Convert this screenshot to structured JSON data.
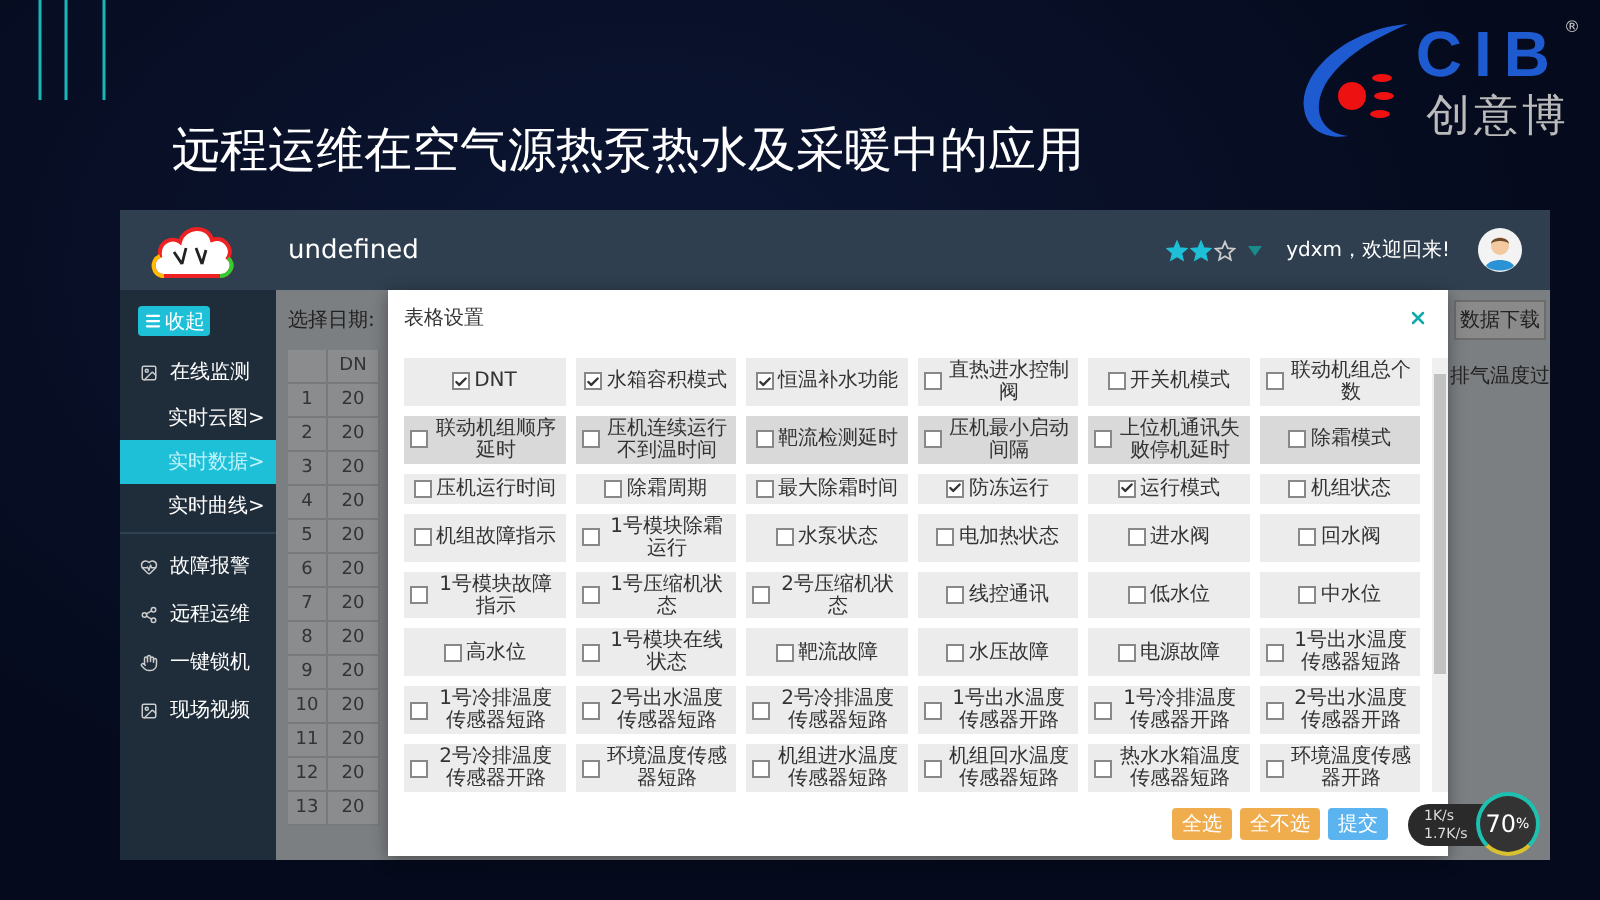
{
  "slide": {
    "title": "远程运维在空气源热泵热水及采暖中的应用"
  },
  "logo": {
    "letters": "CIB",
    "mark": "®",
    "name": "创意博"
  },
  "app": {
    "title": "undefined",
    "rating": {
      "stars": 2
    },
    "greeting": "ydxm，欢迎回来!"
  },
  "sidebar": {
    "toggle": "收起",
    "items": [
      {
        "label": "在线监测",
        "selected": false,
        "children": [
          {
            "label": "实时云图>",
            "selected": false
          },
          {
            "label": "实时数据>",
            "selected": true
          },
          {
            "label": "实时曲线>",
            "selected": false
          }
        ]
      },
      {
        "label": "故障报警",
        "selected": false
      },
      {
        "label": "远程运维",
        "selected": false
      },
      {
        "label": "一键锁机",
        "selected": false
      },
      {
        "label": "现场视频",
        "selected": false
      }
    ]
  },
  "page": {
    "date_label": "选择日期:",
    "download_button": "数据下载",
    "table": {
      "columns": [
        "DN"
      ],
      "rows": [
        {
          "index": "1",
          "cell": "20"
        },
        {
          "index": "2",
          "cell": "20"
        },
        {
          "index": "3",
          "cell": "20"
        },
        {
          "index": "4",
          "cell": "20"
        },
        {
          "index": "5",
          "cell": "20"
        },
        {
          "index": "6",
          "cell": "20"
        },
        {
          "index": "7",
          "cell": "20"
        },
        {
          "index": "8",
          "cell": "20"
        },
        {
          "index": "9",
          "cell": "20"
        },
        {
          "index": "10",
          "cell": "20"
        },
        {
          "index": "11",
          "cell": "20"
        },
        {
          "index": "12",
          "cell": "20"
        },
        {
          "index": "13",
          "cell": "20"
        }
      ],
      "right_column": "排气温度过"
    }
  },
  "dialog": {
    "title": "表格设置",
    "options": [
      {
        "label": "DNT",
        "checked": true,
        "shaded": false
      },
      {
        "label": "水箱容积模式",
        "checked": true,
        "shaded": false
      },
      {
        "label": "恒温补水功能",
        "checked": true,
        "shaded": false
      },
      {
        "label": "直热进水控制阀",
        "checked": false,
        "shaded": false
      },
      {
        "label": "开关机模式",
        "checked": false,
        "shaded": false
      },
      {
        "label": "联动机组总个数",
        "checked": false,
        "shaded": false
      },
      {
        "label": "联动机组顺序延时",
        "checked": false,
        "shaded": true
      },
      {
        "label": "压机连续运行不到温时间",
        "checked": false,
        "shaded": true
      },
      {
        "label": "靶流检测延时",
        "checked": false,
        "shaded": true
      },
      {
        "label": "压机最小启动间隔",
        "checked": false,
        "shaded": true
      },
      {
        "label": "上位机通讯失败停机延时",
        "checked": false,
        "shaded": true
      },
      {
        "label": "除霜模式",
        "checked": false,
        "shaded": true
      },
      {
        "label": "压机运行时间",
        "checked": false,
        "shaded": false
      },
      {
        "label": "除霜周期",
        "checked": false,
        "shaded": false
      },
      {
        "label": "最大除霜时间",
        "checked": false,
        "shaded": false
      },
      {
        "label": "防冻运行",
        "checked": true,
        "shaded": false
      },
      {
        "label": "运行模式",
        "checked": true,
        "shaded": false
      },
      {
        "label": "机组状态",
        "checked": false,
        "shaded": false
      },
      {
        "label": "机组故障指示",
        "checked": false,
        "shaded": false
      },
      {
        "label": "1号模块除霜运行",
        "checked": false,
        "shaded": false
      },
      {
        "label": "水泵状态",
        "checked": false,
        "shaded": false
      },
      {
        "label": "电加热状态",
        "checked": false,
        "shaded": false
      },
      {
        "label": "进水阀",
        "checked": false,
        "shaded": false
      },
      {
        "label": "回水阀",
        "checked": false,
        "shaded": false
      },
      {
        "label": "1号模块故障指示",
        "checked": false,
        "shaded": false
      },
      {
        "label": "1号压缩机状态",
        "checked": false,
        "shaded": false
      },
      {
        "label": "2号压缩机状态",
        "checked": false,
        "shaded": false
      },
      {
        "label": "线控通讯",
        "checked": false,
        "shaded": false
      },
      {
        "label": "低水位",
        "checked": false,
        "shaded": false
      },
      {
        "label": "中水位",
        "checked": false,
        "shaded": false
      },
      {
        "label": "高水位",
        "checked": false,
        "shaded": false
      },
      {
        "label": "1号模块在线状态",
        "checked": false,
        "shaded": false
      },
      {
        "label": "靶流故障",
        "checked": false,
        "shaded": false
      },
      {
        "label": "水压故障",
        "checked": false,
        "shaded": false
      },
      {
        "label": "电源故障",
        "checked": false,
        "shaded": false
      },
      {
        "label": "1号出水温度传感器短路",
        "checked": false,
        "shaded": false
      },
      {
        "label": "1号冷排温度传感器短路",
        "checked": false,
        "shaded": false
      },
      {
        "label": "2号出水温度传感器短路",
        "checked": false,
        "shaded": false
      },
      {
        "label": "2号冷排温度传感器短路",
        "checked": false,
        "shaded": false
      },
      {
        "label": "1号出水温度传感器开路",
        "checked": false,
        "shaded": false
      },
      {
        "label": "1号冷排温度传感器开路",
        "checked": false,
        "shaded": false
      },
      {
        "label": "2号出水温度传感器开路",
        "checked": false,
        "shaded": false
      },
      {
        "label": "2号冷排温度传感器开路",
        "checked": false,
        "shaded": false
      },
      {
        "label": "环境温度传感器短路",
        "checked": false,
        "shaded": false
      },
      {
        "label": "机组进水温度传感器短路",
        "checked": false,
        "shaded": false
      },
      {
        "label": "机组回水温度传感器短路",
        "checked": false,
        "shaded": false
      },
      {
        "label": "热水水箱温度传感器短路",
        "checked": false,
        "shaded": false
      },
      {
        "label": "环境温度传感器开路",
        "checked": false,
        "shaded": false
      }
    ],
    "buttons": [
      {
        "label": "全选",
        "kind": "warning"
      },
      {
        "label": "全不选",
        "kind": "warning"
      },
      {
        "label": "提交",
        "kind": "primary"
      }
    ]
  },
  "speed_widget": {
    "upload": "1K/s",
    "download": "1.7K/s",
    "value": "70",
    "unit": "%"
  }
}
